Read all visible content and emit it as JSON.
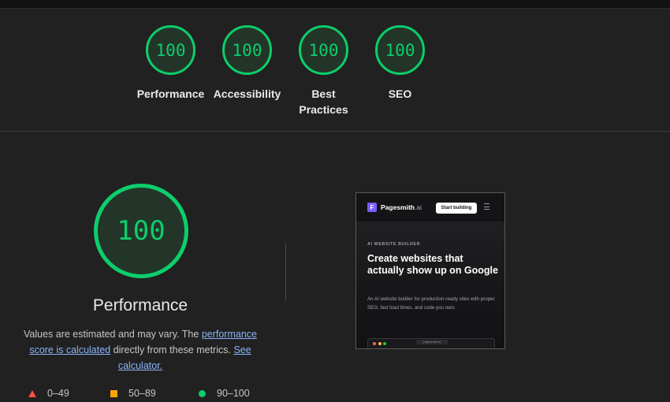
{
  "categories": [
    {
      "score": "100",
      "label": "Performance"
    },
    {
      "score": "100",
      "label": "Accessibility"
    },
    {
      "score": "100",
      "label": "Best Practices"
    },
    {
      "score": "100",
      "label": "SEO"
    }
  ],
  "performance": {
    "score": "100",
    "title": "Performance",
    "desc_prefix": "Values are estimated and may vary. The ",
    "desc_link1": "performance score is calculated",
    "desc_middle": " directly from these metrics. ",
    "desc_link2": "See calculator."
  },
  "legend": [
    {
      "range": "0–49",
      "color": "#ff4e42"
    },
    {
      "range": "50–89",
      "color": "#ffa400"
    },
    {
      "range": "90–100",
      "color": "#0cce6b"
    }
  ],
  "screenshot": {
    "logo_letter": "F",
    "brand": "Pagesmith",
    "brand_suffix": ".ai",
    "cta": "Start building",
    "kicker": "AI WEBSITE BUILDER",
    "headline": "Create websites that actually show up on Google",
    "subtext": "An AI website builder for production-ready sites with proper SEO, fast load times, and code you own.",
    "url": "pagesmith.ai"
  },
  "colors": {
    "pass": "#0cce6b",
    "background": "#212121",
    "link": "#8ab4f8"
  }
}
